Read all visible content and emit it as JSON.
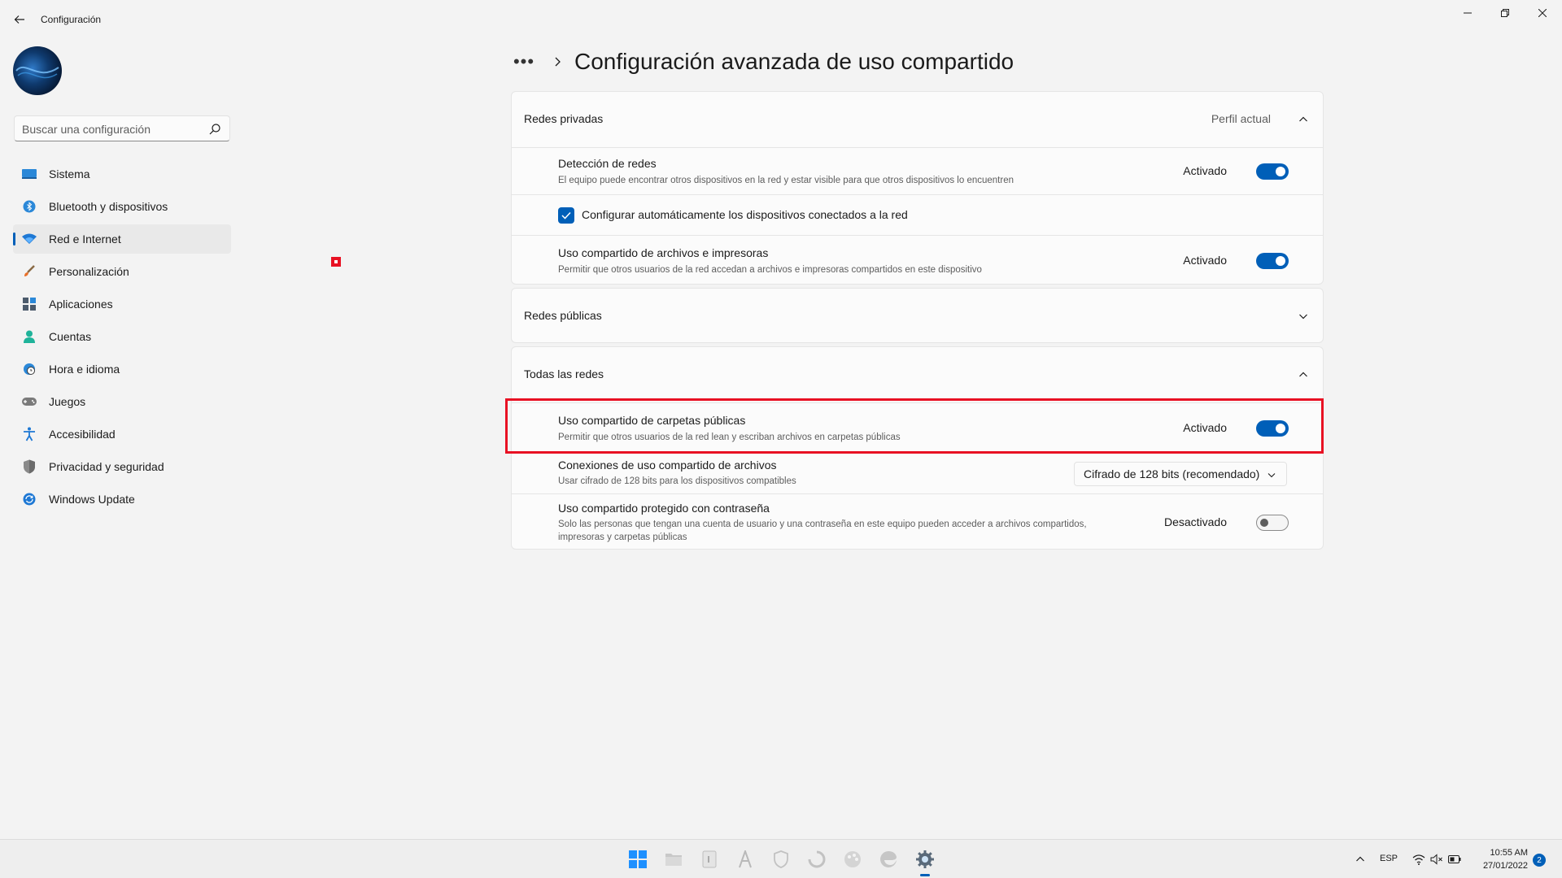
{
  "app": {
    "title": "Configuración",
    "window_controls": [
      "minimize-icon",
      "restore-icon",
      "close-icon"
    ]
  },
  "search": {
    "placeholder": "Buscar una configuración"
  },
  "sidebar": {
    "items": [
      {
        "label": "Sistema",
        "icon": "system-icon",
        "selected": false
      },
      {
        "label": "Bluetooth y dispositivos",
        "icon": "bluetooth-icon",
        "selected": false
      },
      {
        "label": "Red e Internet",
        "icon": "wifi-icon",
        "selected": true
      },
      {
        "label": "Personalización",
        "icon": "brush-icon",
        "selected": false
      },
      {
        "label": "Aplicaciones",
        "icon": "apps-icon",
        "selected": false
      },
      {
        "label": "Cuentas",
        "icon": "account-icon",
        "selected": false
      },
      {
        "label": "Hora e idioma",
        "icon": "globe-clock-icon",
        "selected": false
      },
      {
        "label": "Juegos",
        "icon": "gamepad-icon",
        "selected": false
      },
      {
        "label": "Accesibilidad",
        "icon": "accessibility-icon",
        "selected": false
      },
      {
        "label": "Privacidad y seguridad",
        "icon": "shield-icon",
        "selected": false
      },
      {
        "label": "Windows Update",
        "icon": "update-icon",
        "selected": false
      }
    ]
  },
  "main": {
    "breadcrumb_more": "•••",
    "title": "Configuración avanzada de uso compartido",
    "private": {
      "title": "Redes privadas",
      "current_profile": "Perfil actual",
      "network_discovery": {
        "title": "Detección de redes",
        "desc": "El equipo puede encontrar otros dispositivos en la red y estar visible para que otros dispositivos lo encuentren",
        "state": "Activado",
        "on": true
      },
      "auto_config": {
        "label": "Configurar automáticamente los dispositivos conectados a la red",
        "checked": true
      },
      "file_printer": {
        "title": "Uso compartido de archivos e impresoras",
        "desc": "Permitir que otros usuarios de la red accedan a archivos e impresoras compartidos en este dispositivo",
        "state": "Activado",
        "on": true
      }
    },
    "public": {
      "title": "Redes públicas"
    },
    "all": {
      "title": "Todas las redes",
      "public_folders": {
        "title": "Uso compartido de carpetas públicas",
        "desc": "Permitir que otros usuarios de la red lean y escriban archivos en carpetas públicas",
        "state": "Activado",
        "on": true
      },
      "file_connections": {
        "title": "Conexiones de uso compartido de archivos",
        "desc": "Usar cifrado de 128 bits para los dispositivos compatibles",
        "selected": "Cifrado de 128 bits (recomendado)"
      },
      "password_protected": {
        "title": "Uso compartido protegido con contraseña",
        "desc_line1": "Solo las personas que tengan una cuenta de usuario y una contraseña en este equipo pueden acceder a archivos compartidos,",
        "desc_line2": "impresoras y carpetas públicas",
        "state": "Desactivado",
        "on": false
      }
    }
  },
  "taskbar": {
    "icons": [
      "windows-start-icon",
      "file-explorer-icon",
      "notepad-icon",
      "font-app-icon",
      "shield-app-icon",
      "cortana-icon",
      "paint-icon",
      "edge-icon",
      "settings-icon"
    ],
    "active": "settings-icon",
    "language": "ESP",
    "time": "10:55 AM",
    "date": "27/01/2022",
    "notifications": "2"
  },
  "colors": {
    "accent": "#005fb8",
    "highlight_border": "#e81123",
    "background": "#f3f3f3",
    "card": "#fbfbfb"
  }
}
